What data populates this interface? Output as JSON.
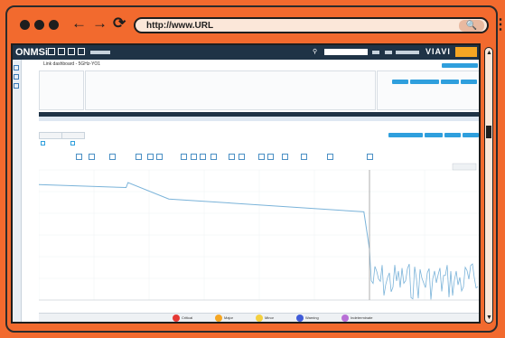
{
  "browser": {
    "url": "http://www.URL",
    "search_symbol": "🔍",
    "kebab": "⋮",
    "back": "←",
    "forward": "→",
    "reload": "⟳"
  },
  "app": {
    "logo": "ONMSi",
    "brand": "VIAVI",
    "page_title": "Link dashboard - 5GHz-YO1"
  },
  "legend": [
    {
      "label": "Critical",
      "color": "#e53935"
    },
    {
      "label": "Major",
      "color": "#f5a623"
    },
    {
      "label": "Minor",
      "color": "#f4d03f"
    },
    {
      "label": "Warning",
      "color": "#3f5bd9"
    },
    {
      "label": "Indeterminate",
      "color": "#b86fd6"
    }
  ],
  "chart_data": {
    "type": "line",
    "series": [
      {
        "x": [
          0,
          0.47,
          0.48,
          0.7,
          1.75,
          1.78
        ],
        "y": [
          0.08,
          0.12,
          0.05,
          0.28,
          0.46,
          0.98
        ]
      }
    ],
    "grid": true,
    "legend_placement": "bottom"
  },
  "colors": {
    "background": "#f26a2e",
    "appbar": "#1f3346",
    "accent": "#2f9fdd",
    "trace": "#7ab3d9"
  }
}
